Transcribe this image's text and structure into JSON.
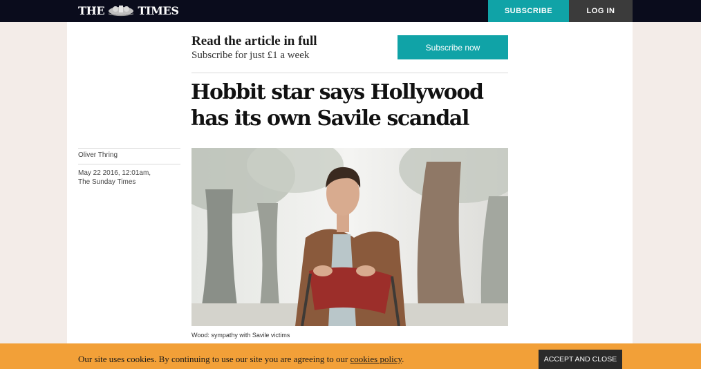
{
  "header": {
    "logo_left": "THE",
    "logo_right": "TIMES",
    "subscribe_label": "SUBSCRIBE",
    "login_label": "LOG IN"
  },
  "promo": {
    "title": "Read the article in full",
    "subtitle": "Subscribe for just £1 a week",
    "button_label": "Subscribe now"
  },
  "article": {
    "headline": "Hobbit star says Hollywood has its own Savile scandal",
    "author": "Oliver Thring",
    "date": "May 22 2016, 12:01am,",
    "publication": "The Sunday Times",
    "caption": "Wood: sympathy with Savile victims"
  },
  "cookie_banner": {
    "text": "Our site uses cookies. By continuing to use our site you are agreeing to our ",
    "link_label": "cookies policy",
    "period": ".",
    "accept_label": "ACCEPT AND CLOSE"
  },
  "colors": {
    "topbar": "#0a0c1c",
    "accent_teal": "#10a3a7",
    "cookie_bg": "#f2a038"
  }
}
